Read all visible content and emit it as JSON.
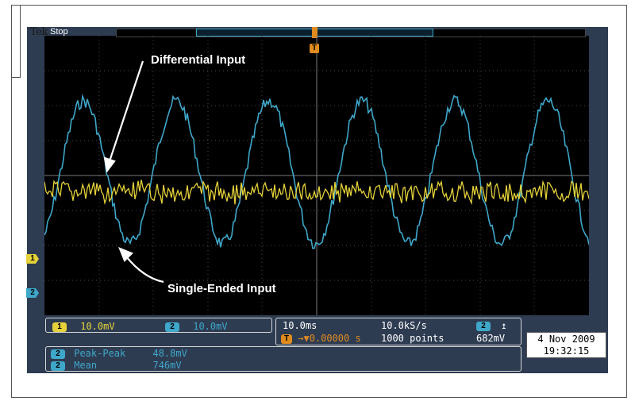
{
  "window": {
    "brand": "Tek",
    "run_state": "Stop"
  },
  "annotations": {
    "differential": "Differential Input",
    "single_ended": "Single-Ended Input"
  },
  "markers": {
    "trigger": "T",
    "ch1": "1",
    "ch2": "2"
  },
  "channels": {
    "ch1": {
      "number": "1",
      "scale": "10.0mV",
      "color": "#e5d23a"
    },
    "ch2": {
      "number": "2",
      "scale": "10.0mV",
      "color": "#3fa7c9"
    }
  },
  "timebase": {
    "time_div": "10.0ms",
    "trigger_position": "0.00000 s",
    "sample_rate": "10.0kS/s",
    "record_length": "1000 points"
  },
  "trigger": {
    "source": "2",
    "slope_icon": "rising-edge-icon",
    "level": "682mV"
  },
  "measurements": [
    {
      "channel": "2",
      "label": "Peak-Peak",
      "value": "48.8mV"
    },
    {
      "channel": "2",
      "label": "Mean",
      "value": "746mV"
    }
  ],
  "datetime": {
    "date": "4 Nov 2009",
    "time": "19:32:15"
  },
  "colors": {
    "bezel": "#2e3c52",
    "ch1": "#e5d23a",
    "ch2": "#3fa7c9",
    "trigger": "#e08b1e"
  }
}
